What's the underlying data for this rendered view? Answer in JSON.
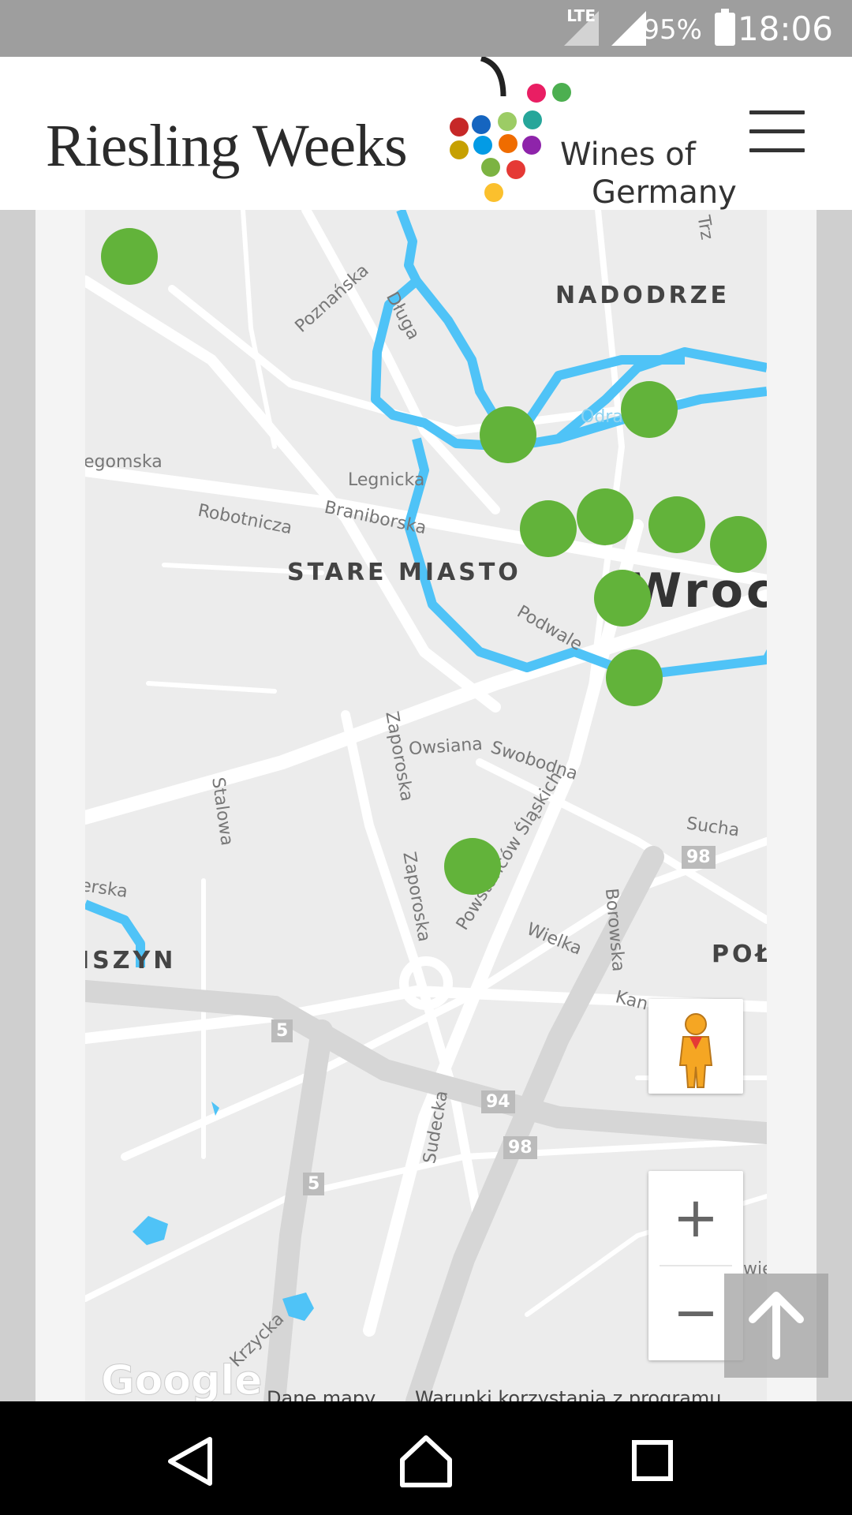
{
  "status_bar": {
    "network": "LTE",
    "battery": "95%",
    "time": "18:06"
  },
  "header": {
    "brand_title": "Riesling Weeks",
    "logo_line1": "Wines of",
    "logo_line2": "Germany"
  },
  "map": {
    "districts": [
      "NADODRZE",
      "STARE MIASTO",
      "ISZYN",
      "POŁ"
    ],
    "city": "Wrocł",
    "streets": [
      "Poznańska",
      "Długa",
      "egomska",
      "Legnicka",
      "Robotnicza",
      "Braniborska",
      "Podwale",
      "Owsiana",
      "Swobodna",
      "Zaporoska",
      "Zaporoska",
      "Stalowa",
      "Powstańców Śląskich",
      "Sucha",
      "Borowska",
      "erska",
      "Wielka",
      "Kan",
      "Sudecka",
      "Krzycka",
      "Trz",
      "wie",
      "Odra"
    ],
    "road_numbers": [
      "98",
      "5",
      "94",
      "98",
      "5"
    ],
    "marker_count": 11,
    "attribution_logo": "Google",
    "attribution_data": "Dane mapy",
    "attribution_terms": "Warunki korzystania z programu",
    "water_color": "#4fc3f7",
    "marker_color": "#62b33a"
  },
  "controls": {
    "zoom_in": "+",
    "zoom_out": "−",
    "pegman_icon": "pegman-icon",
    "back_to_top_icon": "arrow-up-icon"
  },
  "nav": {
    "back_icon": "back-triangle-icon",
    "home_icon": "home-icon",
    "recents_icon": "recents-square-icon"
  }
}
